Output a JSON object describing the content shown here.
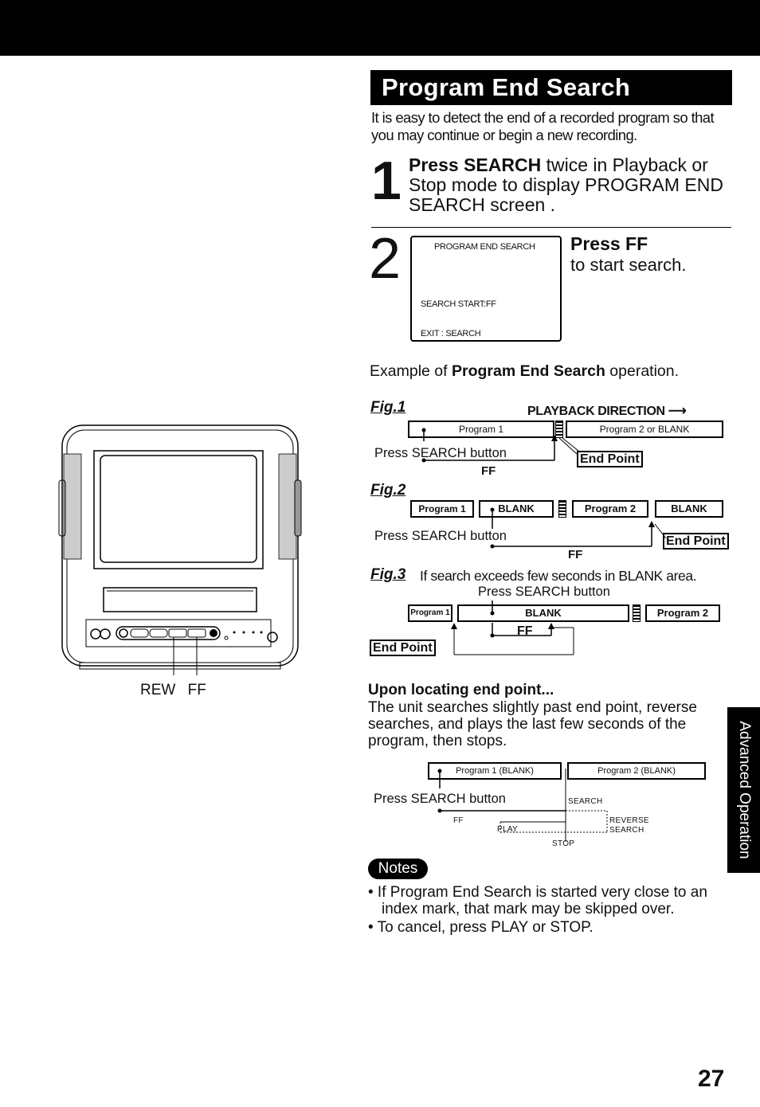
{
  "header": {
    "title": "Program End Search"
  },
  "intro": "It is easy to detect the end of a recorded program so that you may continue or begin a new recording.",
  "step1": {
    "number": "1",
    "bold": "Press SEARCH",
    "text": " twice in Playback or Stop mode to display PROGRAM END SEARCH screen ."
  },
  "step2": {
    "number": "2",
    "osd": {
      "line1": "PROGRAM END SEARCH",
      "line2": "SEARCH START:FF",
      "line3": "EXIT : SEARCH"
    },
    "bold": "Press FF",
    "text": "to start search."
  },
  "example": {
    "prefix": "Example of ",
    "bold": "Program End Search",
    "suffix": " operation."
  },
  "fig1": {
    "label": "Fig.1",
    "direction": "PLAYBACK DIRECTION",
    "segments": [
      "Program 1",
      "Program 2 or BLANK"
    ],
    "press": "Press SEARCH button",
    "ff": "FF",
    "end_point": "End Point"
  },
  "fig2": {
    "label": "Fig.2",
    "segments": [
      "Program 1",
      "BLANK",
      "Program 2",
      "BLANK"
    ],
    "press": "Press SEARCH button",
    "ff": "FF",
    "end_point": "End Point"
  },
  "fig3": {
    "label": "Fig.3",
    "caption": "If search exceeds few seconds in BLANK area.",
    "press": "Press SEARCH button",
    "segments": [
      "Program 1",
      "BLANK",
      "Program 2"
    ],
    "ff": "FF",
    "end_point": "End Point"
  },
  "upon": {
    "title": "Upon locating end point...",
    "text": "The unit searches slightly past end point, reverse searches, and plays the last few seconds of the program, then stops."
  },
  "fig4": {
    "segments": [
      "Program 1 (BLANK)",
      "Program 2 (BLANK)"
    ],
    "press": "Press SEARCH button",
    "search": "SEARCH",
    "ff": "FF",
    "play": "PLAY",
    "reverse1": "REVERSE",
    "reverse2": "SEARCH",
    "stop": "STOP"
  },
  "notes": {
    "badge": "Notes",
    "items": [
      "• If Program End Search is started very close to an index mark, that mark may be skipped over.",
      "• To cancel, press PLAY or STOP."
    ]
  },
  "device": {
    "rew_ff_label": "REW FF"
  },
  "side_tab": "Advanced Operation",
  "page_number": "27"
}
